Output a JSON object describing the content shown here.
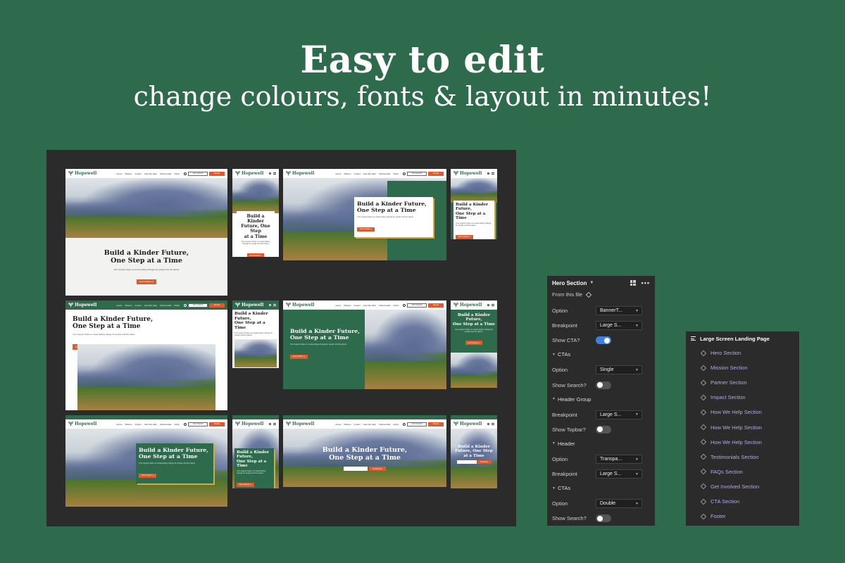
{
  "headline": "Easy to edit",
  "subline": "change colours, fonts & layout in minutes!",
  "mockup": {
    "brand": "Hopewell",
    "nav_links": [
      "Home",
      "Mission",
      "Impact",
      "How We Help",
      "Testimonials",
      "FAQs"
    ],
    "btn_outline": "Get Involved",
    "btn_donate": "Donate",
    "hero_title_1": "Build a Kinder Future,",
    "hero_title_2": "One Step at a Time",
    "hero_title_short_1": "Build a Kinder",
    "hero_title_short_2": "Future, One Step",
    "hero_title_short_3": "at a Time",
    "hero_text": "Your support helps us create lasting change for people and the planet.",
    "cta_label": "Get Involved",
    "subscribe_label": "Subscribe"
  },
  "props_panel": {
    "title": "Hero Section",
    "from_file": "From this file",
    "rows": [
      {
        "label": "Option",
        "value": "BannerT..."
      },
      {
        "label": "Breakpoint",
        "value": "Large S..."
      },
      {
        "label": "Show CTA?",
        "toggle": true
      },
      {
        "section": "CTAs"
      },
      {
        "label": "Option",
        "value": "Single"
      },
      {
        "label": "Show Search?",
        "toggle": false
      },
      {
        "section": "Header Group"
      },
      {
        "label": "Breakpoint",
        "value": "Large S..."
      },
      {
        "label": "Show Topbar?",
        "toggle": false
      },
      {
        "section": "Header"
      },
      {
        "label": "Option",
        "value": "Transpa..."
      },
      {
        "label": "Breakpoint",
        "value": "Large S..."
      },
      {
        "section": "CTAs"
      },
      {
        "label": "Option",
        "value": "Double"
      },
      {
        "label": "Show Search?",
        "toggle": false
      }
    ]
  },
  "layers_panel": {
    "title": "Large Screen Landing Page",
    "items": [
      "Hero Section",
      "Mission Section",
      "Partner Section",
      "Impact Section",
      "How We Help Section",
      "How We Help Section",
      "How We Help Section",
      "Testimonials Section",
      "FAQs Section",
      "Get Involved Section",
      "CTA Section",
      "Footer"
    ]
  },
  "colors": {
    "brand_green": "#2e6b4c",
    "accent_orange": "#e05a2b",
    "toggle_blue": "#3d80e0",
    "panel_bg": "#2b2b2b",
    "link_purple": "#b9a6e6"
  }
}
